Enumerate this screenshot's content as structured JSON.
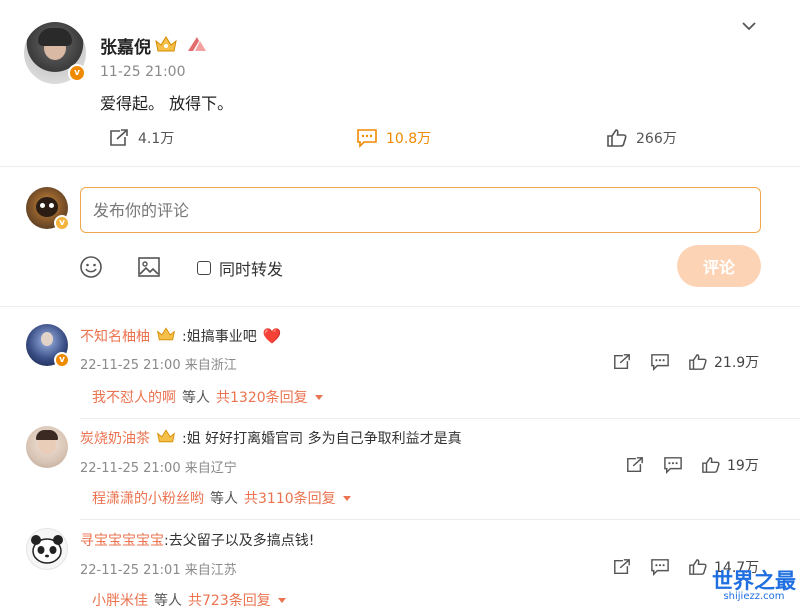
{
  "post": {
    "author": "张嘉倪",
    "time": "11-25 21:00",
    "text": "爱得起。 放得下。",
    "stats": {
      "repost": "4.1万",
      "comment": "10.8万",
      "like": "266万"
    }
  },
  "composer": {
    "placeholder": "发布你的评论",
    "repost_label": "同时转发",
    "submit_label": "评论"
  },
  "comments": [
    {
      "name": "不知名柚柚",
      "text": ":姐搞事业吧",
      "emoji": "❤️",
      "meta": "22-11-25 21:00 来自浙江",
      "likes": "21.9万",
      "reply_user": "我不怼人的啊",
      "reply_mid": "等人",
      "reply_count": "共1320条回复"
    },
    {
      "name": "炭烧奶油茶",
      "text": ":姐 好好打离婚官司 多为自己争取利益才是真",
      "meta": "22-11-25 21:00 来自辽宁",
      "likes": "19万",
      "reply_user": "程潇潇的小粉丝哟",
      "reply_mid": "等人",
      "reply_count": "共3110条回复"
    },
    {
      "name": "寻宝宝宝宝宝",
      "text": ":去父留子以及多搞点钱!",
      "meta": "22-11-25 21:01 来自江苏",
      "likes": "14.7万",
      "reply_user": "小胖米佳",
      "reply_mid": "等人",
      "reply_count": "共723条回复"
    }
  ],
  "watermark": {
    "main": "世界之最",
    "sub": "shijiezz.com"
  },
  "colors": {
    "accent": "#f08a00",
    "username": "#eb7350",
    "submit_bg": "#fcd3b4",
    "input_border": "#f0a74a"
  }
}
